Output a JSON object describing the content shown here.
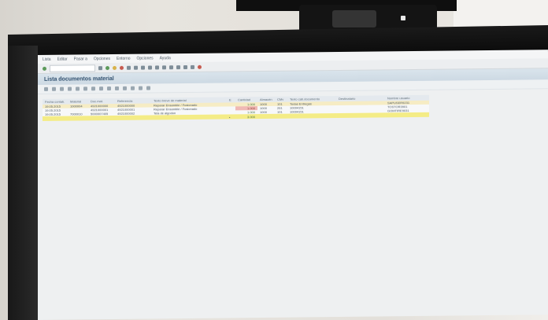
{
  "window": {
    "title": "Lista documentos material"
  },
  "menubar": {
    "items": [
      "Lista",
      "Editar",
      "Pasar a",
      "Opciones",
      "Entorno",
      "Opciones",
      "Ayuda"
    ]
  },
  "grid": {
    "headers": [
      "Fecha contab.",
      "Material",
      "Doc.mat.",
      "Referencia",
      "Texto breve de material",
      "E",
      "Cantidad",
      "Almacén",
      "CMv",
      "Texto cab.documento",
      "Destinatario",
      "Nombre usuario"
    ],
    "rows": [
      [
        "19.05.2015",
        "1000004",
        "4921000000",
        "4921000000",
        "Reparar Ensamble / Fusionado",
        "",
        "1.000",
        "1000",
        "101",
        "Todas Entregas",
        "",
        "SAPUSER9231"
      ],
      [
        "19.05.2015",
        "",
        "4921000001",
        "4921000001",
        "Reparar Ensamble / Fusionado",
        "",
        "1.000",
        "1000",
        "261",
        "10004151",
        "",
        "TOSTOR3901"
      ],
      [
        "19.05.2015",
        "7000010",
        "5000007405",
        "4921000002",
        "Tela de algodon",
        "",
        "1.000",
        "1000",
        "101",
        "10004151",
        "",
        "GOMTIRE9031"
      ]
    ],
    "total": {
      "marker": "•",
      "quantity": "3.000"
    }
  }
}
